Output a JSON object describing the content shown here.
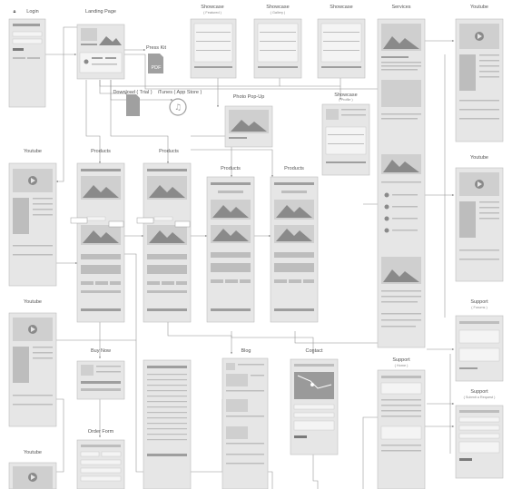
{
  "frames": [
    {
      "id": "login",
      "title": "Login",
      "subtitle": "",
      "has_lock_icon": true
    },
    {
      "id": "landing",
      "title": "Landing Page",
      "subtitle": ""
    },
    {
      "id": "press_kit",
      "title": "Press Kit",
      "subtitle": "",
      "file_label": "PDF"
    },
    {
      "id": "showcase_featured",
      "title": "Showcase",
      "subtitle": "( Featured )"
    },
    {
      "id": "showcase_gallery",
      "title": "Showcase",
      "subtitle": "( Gallery )"
    },
    {
      "id": "showcase_3",
      "title": "Showcase",
      "subtitle": ""
    },
    {
      "id": "services",
      "title": "Services",
      "subtitle": ""
    },
    {
      "id": "youtube_right_1",
      "title": "Youtube",
      "subtitle": ""
    },
    {
      "id": "download_trial",
      "title": "Download ( Trial )",
      "subtitle": ""
    },
    {
      "id": "itunes",
      "title": "iTunes ( App Store )",
      "subtitle": ""
    },
    {
      "id": "photo_popup",
      "title": "Photo Pop-Up",
      "subtitle": ""
    },
    {
      "id": "showcase_profile",
      "title": "Showcase",
      "subtitle": "( Profile )"
    },
    {
      "id": "youtube_left_1",
      "title": "Youtube",
      "subtitle": ""
    },
    {
      "id": "products_1",
      "title": "Products",
      "subtitle": ""
    },
    {
      "id": "products_2",
      "title": "Products",
      "subtitle": ""
    },
    {
      "id": "products_3",
      "title": "Products",
      "subtitle": ""
    },
    {
      "id": "products_4",
      "title": "Products",
      "subtitle": ""
    },
    {
      "id": "youtube_right_2",
      "title": "Youtube",
      "subtitle": ""
    },
    {
      "id": "youtube_left_2",
      "title": "Youtube",
      "subtitle": ""
    },
    {
      "id": "support_forums",
      "title": "Support",
      "subtitle": "( Forums )"
    },
    {
      "id": "buy_now",
      "title": "Buy Now",
      "subtitle": ""
    },
    {
      "id": "blog",
      "title": "Blog",
      "subtitle": ""
    },
    {
      "id": "contact",
      "title": "Contact",
      "subtitle": ""
    },
    {
      "id": "support_home",
      "title": "Support",
      "subtitle": "( Home )"
    },
    {
      "id": "support_request",
      "title": "Support",
      "subtitle": "( Submit a Request )"
    },
    {
      "id": "order_form",
      "title": "Order Form",
      "subtitle": ""
    },
    {
      "id": "youtube_left_3",
      "title": "Youtube",
      "subtitle": ""
    }
  ],
  "colors": {
    "frame": "#e6e6e6",
    "bar": "#9e9e9e",
    "connector": "#8f8f8f",
    "label": "#555555"
  }
}
